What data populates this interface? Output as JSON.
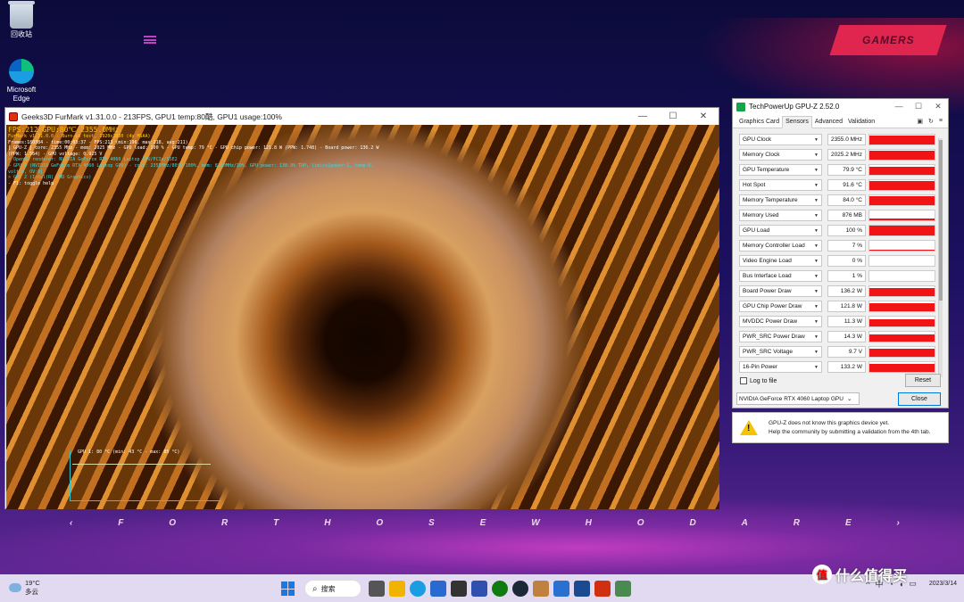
{
  "desktop": {
    "recycle_bin": "回收站",
    "edge_label_1": "Microsoft",
    "edge_label_2": "Edge",
    "gamers_logo": "GAMERS",
    "slogan": [
      "‹",
      "F",
      "O",
      "R",
      "T",
      "H",
      "O",
      "S",
      "E",
      "W",
      "H",
      "O",
      "D",
      "A",
      "R",
      "E",
      "›"
    ]
  },
  "furmark": {
    "title": "Geeks3D FurMark v1.31.0.0 - 213FPS, GPU1 temp:80酷, GPU1 usage:100%",
    "controls": [
      "—",
      "☐",
      "✕"
    ],
    "overlay": {
      "big_line": "FPS:212  GPU:80℃  2355.0MHz",
      "line1": "FurMark v1.31.0.0 - Burn-in test, 1920x1080 (4x MSAA)",
      "line2": "Frames:180384 - time:00:03:37 - FPS:213 (min:196, max:218, avg:211)",
      "line3": "[ GPU-Z ] core: 2355 MHz - mem: 2025 MHz - GPU load: 100 % - GPU temp: 79 °C - GPU chip power: 121.8 W (PPW: 1.748) - Board power: 136.2 W (PPW: 1.564) - GPU voltage: 0.925 V",
      "line4": "> OpenGL renderer: NVIDIA GeForce RTX 4060 Laptop GPU/PCIe/SSE2",
      "line5": "> GPU 1 (NVIDIA GeForce RTX 4060 Laptop GPU) - core: 2355MHz/80°C/100%, mem: 8100MHz/10%, GPU power: 138.9% TDP, limits[power:1, temp:0, volt:0, OV:0]",
      "line6": "> GPU 2 (Intel(R) UHD Graphics)",
      "line7": "- F1: toggle help"
    },
    "graph_label": "GPU 1: 80 °C (min: 43 °C - max: 85 °C)"
  },
  "gpuz": {
    "title": "TechPowerUp GPU-Z 2.52.0",
    "tabs": [
      "Graphics Card",
      "Sensors",
      "Advanced",
      "Validation"
    ],
    "sensors": [
      {
        "name": "GPU Clock",
        "value": "2355.0 MHz",
        "level": 0.9
      },
      {
        "name": "Memory Clock",
        "value": "2025.2 MHz",
        "level": 0.95
      },
      {
        "name": "GPU Temperature",
        "value": "79.9 °C",
        "level": 0.85
      },
      {
        "name": "Hot Spot",
        "value": "91.6 °C",
        "level": 0.9
      },
      {
        "name": "Memory Temperature",
        "value": "84.0 °C",
        "level": 0.88
      },
      {
        "name": "Memory Used",
        "value": "876 MB",
        "level": 0.15
      },
      {
        "name": "GPU Load",
        "value": "100 %",
        "level": 1.0
      },
      {
        "name": "Memory Controller Load",
        "value": "7 %",
        "level": 0.08
      },
      {
        "name": "Video Engine Load",
        "value": "0 %",
        "level": 0.0
      },
      {
        "name": "Bus Interface Load",
        "value": "1 %",
        "level": 0.03
      },
      {
        "name": "Board Power Draw",
        "value": "136.2 W",
        "level": 0.85
      },
      {
        "name": "GPU Chip Power Draw",
        "value": "121.8 W",
        "level": 0.8
      },
      {
        "name": "MVDDC Power Draw",
        "value": "11.3 W",
        "level": 0.7
      },
      {
        "name": "PWR_SRC Power Draw",
        "value": "14.3 W",
        "level": 0.75
      },
      {
        "name": "PWR_SRC Voltage",
        "value": "9.7 V",
        "level": 0.8
      },
      {
        "name": "16-Pin Power",
        "value": "133.2 W",
        "level": 0.85
      }
    ],
    "log_label": "Log to file",
    "reset_label": "Reset",
    "gpu_select": "NVIDIA GeForce RTX 4060 Laptop GPU",
    "close_label": "Close",
    "note_line1": "GPU-Z does not know this graphics device yet.",
    "note_line2": "Help the community by submitting a validation from the 4th tab."
  },
  "taskbar": {
    "temp": "19°C",
    "weather": "多云",
    "search": "搜索",
    "time": "",
    "date": "2023/3/14",
    "ime": "中"
  },
  "watermark": {
    "badge": "值",
    "text": "什么值得买"
  },
  "colors": {
    "sensor_bar": "#f21414",
    "accent": "#0078d7",
    "warn": "#f5c400"
  }
}
